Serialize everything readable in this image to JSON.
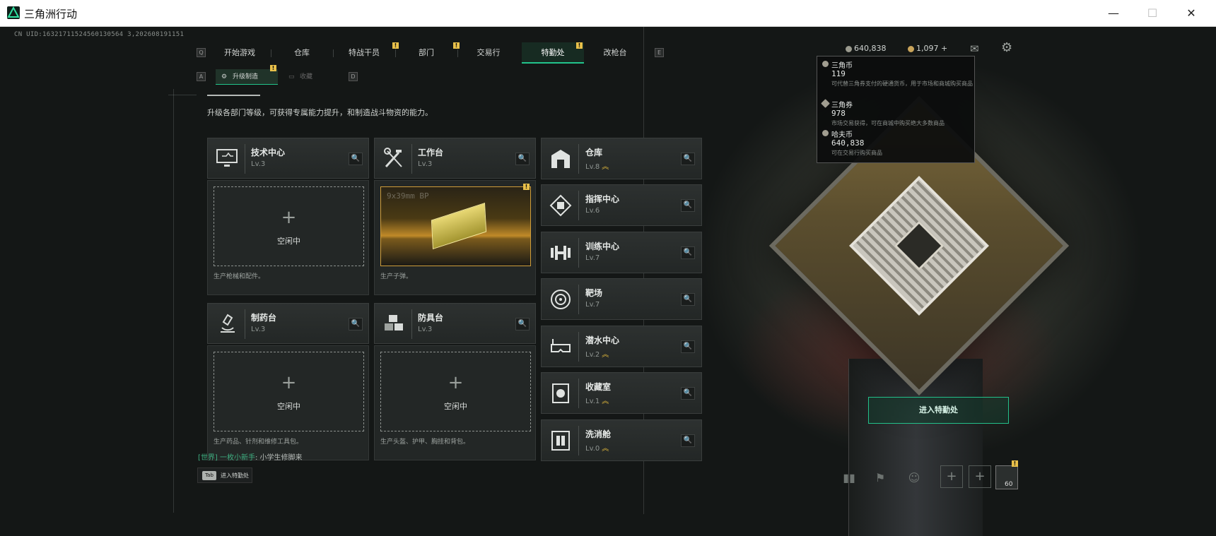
{
  "window": {
    "title": "三角洲行动",
    "controls": [
      "—",
      "☐",
      "✕"
    ]
  },
  "uid": "CN UID:16321711524560130564 3,202608191151",
  "nav": {
    "key_left": "Q",
    "key_right": "E",
    "tabs": [
      {
        "label": "开始游戏",
        "badge": ""
      },
      {
        "label": "仓库",
        "badge": ""
      },
      {
        "label": "特战干员",
        "badge": "!"
      },
      {
        "label": "部门",
        "badge": "!"
      },
      {
        "label": "交易行",
        "badge": ""
      },
      {
        "label": "特勤处",
        "badge": "!",
        "active": true
      },
      {
        "label": "改枪台",
        "badge": ""
      }
    ]
  },
  "subnav": {
    "key_left": "A",
    "key_right": "D",
    "tabs": [
      {
        "label": "升级制造",
        "badge": "!",
        "active": true
      },
      {
        "label": "收藏",
        "badge": ""
      }
    ]
  },
  "subtitle": "升级各部门等级，可获得专属能力提升，和制造战斗物资的能力。",
  "cards": [
    {
      "name": "技术中心",
      "level": "Lv.3",
      "icon": "computer-icon",
      "body": "idle",
      "idle_label": "空闲中",
      "desc": "生产枪械和配件。"
    },
    {
      "name": "工作台",
      "level": "Lv.3",
      "icon": "tools-icon",
      "body": "item",
      "item_label": "9x39mm BP",
      "badge": "!",
      "desc": "生产子弹。"
    },
    {
      "name": "制药台",
      "level": "Lv.3",
      "icon": "microscope-icon",
      "body": "idle",
      "idle_label": "空闲中",
      "desc": "生产药品、针剂和维修工具包。"
    },
    {
      "name": "防具台",
      "level": "Lv.3",
      "icon": "armor-icon",
      "body": "idle",
      "idle_label": "空闲中",
      "desc": "生产头盔、护甲、胸挂和背包。"
    }
  ],
  "facilities": [
    {
      "name": "仓库",
      "level": "Lv.8",
      "upgrade": "︽",
      "icon": "warehouse-icon"
    },
    {
      "name": "指挥中心",
      "level": "Lv.6",
      "upgrade": "",
      "icon": "command-icon"
    },
    {
      "name": "训练中心",
      "level": "Lv.7",
      "upgrade": "",
      "icon": "dumbbell-icon"
    },
    {
      "name": "靶场",
      "level": "Lv.7",
      "upgrade": "",
      "icon": "target-icon"
    },
    {
      "name": "潜水中心",
      "level": "Lv.2",
      "upgrade": "︽",
      "icon": "diving-mask-icon"
    },
    {
      "name": "收藏室",
      "level": "Lv.1",
      "upgrade": "︽",
      "icon": "collection-icon"
    },
    {
      "name": "洗消舱",
      "level": "Lv.0",
      "upgrade": "︽",
      "icon": "decon-icon"
    }
  ],
  "currency": {
    "haf": "640,838",
    "delta_coin": "1,097",
    "plus": "+"
  },
  "tooltip": [
    {
      "name": "三角币",
      "value": "119",
      "desc": "可代替三角券支付的硬通货币，用于市场和商城购买商品"
    },
    {
      "name": "三角券",
      "value": "978",
      "desc": "市场交易获得，可在商城中购买绝大多数商品"
    },
    {
      "name": "哈夫币",
      "value": "640,838",
      "desc": "可在交易行购买商品"
    }
  ],
  "enter_button": "进入特勤处",
  "chat": {
    "channel": "[世界]",
    "user": "一枚小新手",
    "message": ": 小学生修脚来"
  },
  "tab_hint": {
    "key": "Tab",
    "text": "进入特勤处"
  },
  "squad": {
    "count": "60",
    "badge": "!"
  },
  "colors": {
    "accent": "#22c48b",
    "badge": "#e8c04a",
    "upgrade": "#e2b93c",
    "ammo": "#c08a28"
  }
}
